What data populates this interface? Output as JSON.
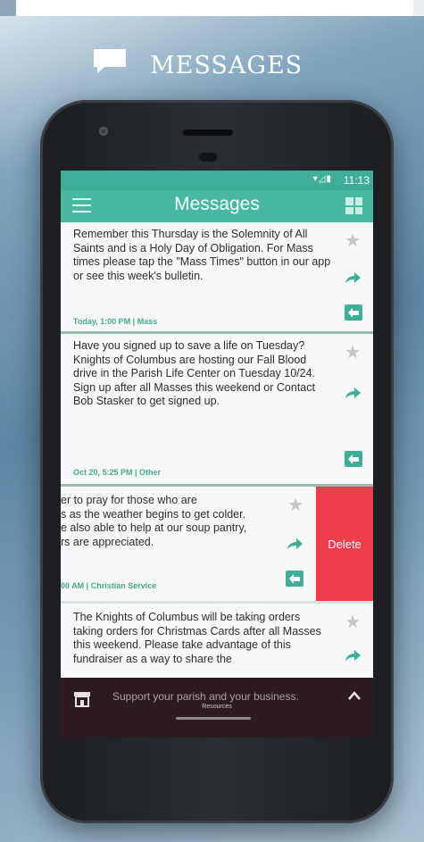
{
  "promo": {
    "title": "MESSAGES",
    "icon": "chat-bubble-icon"
  },
  "status": {
    "time": "11:13",
    "icons": "wifi-icon signal-icon battery-icon"
  },
  "appbar": {
    "title": "Messages",
    "menu_icon": "hamburger-icon",
    "view_icon": "grid-icon"
  },
  "messages": [
    {
      "text": "Remember this Thursday is the Solemnity of All Saints and is a Holy Day of Obligation. For Mass times please tap the \"Mass Times\" button in our app or see this week's bulletin.",
      "meta": "Today, 1:00 PM | Mass"
    },
    {
      "text": "Have you signed up to save a life on Tuesday? Knights of Columbus are hosting our Fall Blood drive in the Parish Life Center on Tuesday 10/24. Sign up after all Masses this weekend or Contact Bob Stasker to get signed up.",
      "meta": "Oct 20, 5:25 PM | Other"
    },
    {
      "lines": [
        "er to pray for those who are",
        "s as the weather begins to get colder.",
        "e also able to help at our soup pantry,",
        "rs are appreciated."
      ],
      "meta": "00 AM | Christian Service",
      "action": "Delete"
    },
    {
      "text": "The Knights of Columbus will be taking orders taking orders for Christmas Cards after all Masses this weekend. Please take advantage of this fundraiser as a way to share the"
    }
  ],
  "bottombar": {
    "promo_text": "Support your parish and your business.",
    "label": "Resources"
  },
  "colors": {
    "accent": "#48b8a1",
    "delete": "#ee3d4b",
    "bottom": "#2c1c1f"
  }
}
